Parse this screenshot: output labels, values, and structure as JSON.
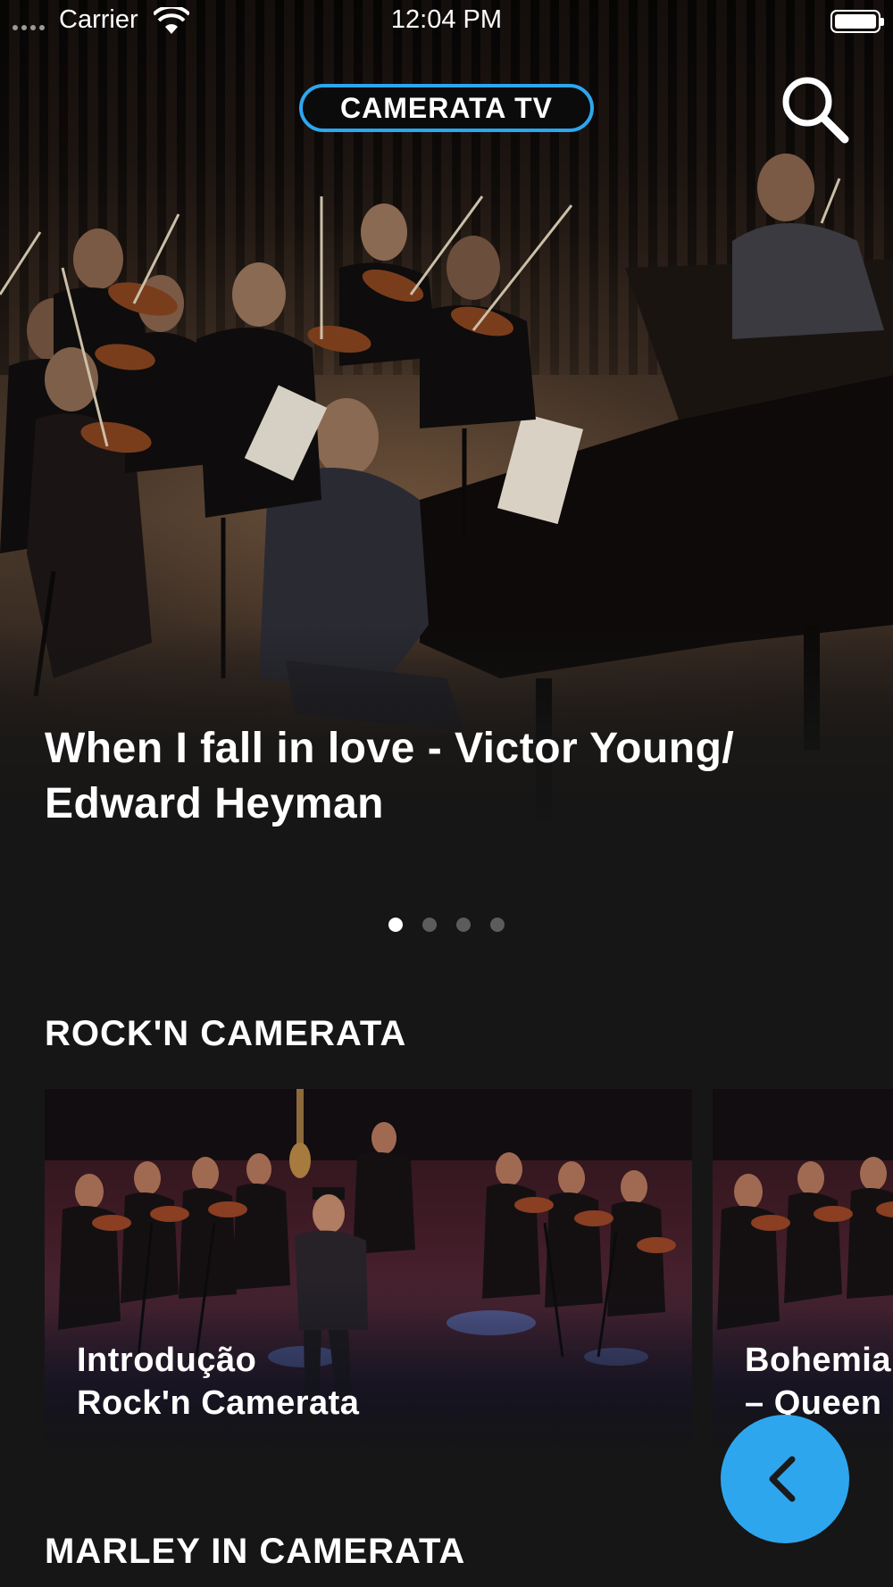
{
  "status_bar": {
    "carrier": "Carrier",
    "time": "12:04 PM",
    "icons": [
      "signal-dots-icon",
      "wifi-icon",
      "battery-icon"
    ]
  },
  "header": {
    "brand": "CAMERATA TV",
    "search_icon": "search-icon",
    "accent_color": "#2ea6ee"
  },
  "hero": {
    "title": "When I fall in love - Victor Young/ Edward Heyman",
    "carousel": {
      "total": 4,
      "active_index": 0
    }
  },
  "sections": [
    {
      "title": "ROCK'N CAMERATA",
      "cards": [
        {
          "title": "Introdução\nRock'n Camerata"
        },
        {
          "title": "Bohemia\n– Queen"
        }
      ]
    },
    {
      "title": "MARLEY IN CAMERATA"
    }
  ],
  "fab": {
    "icon": "chevron-left-icon",
    "color": "#2ea6ee"
  },
  "colors": {
    "background": "#161616",
    "text": "#ffffff",
    "dot_inactive": "#5c5c5c"
  }
}
